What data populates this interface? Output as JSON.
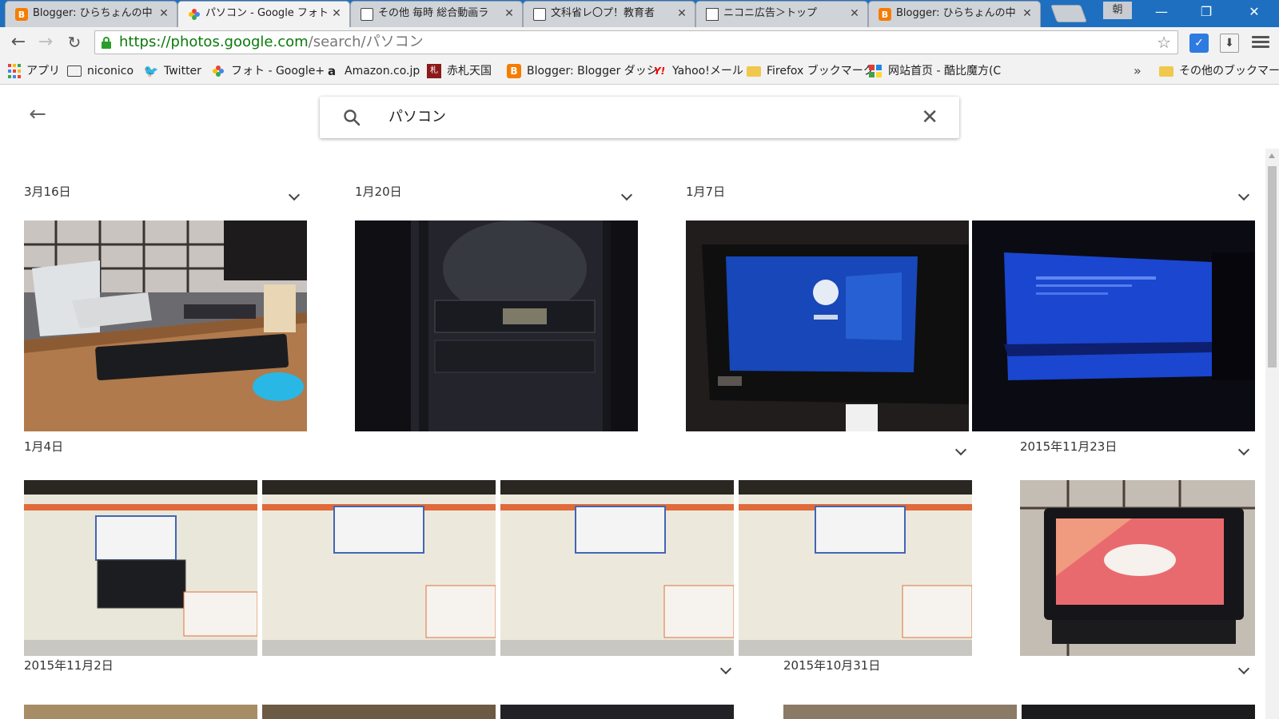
{
  "browser": {
    "tabs": [
      {
        "title": "Blogger: ひらちょんの中",
        "icon": "blogger-icon",
        "active": false
      },
      {
        "title": "パソコン - Google フォト",
        "icon": "google-photos-icon",
        "active": true
      },
      {
        "title": "その他 毎時 総合動画ラ",
        "icon": "niconico-tv-icon",
        "active": false
      },
      {
        "title": "文科省レ〇プ！教育者",
        "icon": "niconico-tv-icon",
        "active": false
      },
      {
        "title": "ニコニ広告＞トップ",
        "icon": "nicoad-icon",
        "active": false
      },
      {
        "title": "Blogger: ひらちょんの中",
        "icon": "blogger-icon",
        "active": false
      }
    ],
    "ime_indicator": "朝",
    "url": {
      "scheme_host": "https://photos.google.com",
      "path": "/search/パソコン"
    },
    "bookmarks": [
      {
        "label": "アプリ",
        "icon": "apps-grid-icon"
      },
      {
        "label": "niconico",
        "icon": "niconico-tv-icon"
      },
      {
        "label": "Twitter",
        "icon": "twitter-bird-icon"
      },
      {
        "label": "フォト - Google+",
        "icon": "google-photos-icon"
      },
      {
        "label": "Amazon.co.jp",
        "icon": "amazon-icon"
      },
      {
        "label": "赤札天国",
        "icon": "akafuda-icon"
      },
      {
        "label": "Blogger: Blogger ダッシ",
        "icon": "blogger-icon"
      },
      {
        "label": "Yahoo!メール",
        "icon": "yahoo-icon"
      },
      {
        "label": "Firefox ブックマーク",
        "icon": "folder-icon"
      },
      {
        "label": "网站首页 - 酷比魔方(C",
        "icon": "cube-site-icon"
      }
    ],
    "bookmarks_overflow": "»",
    "other_bookmarks": "その他のブックマーク"
  },
  "photos": {
    "search_query": "パソコン",
    "groups": [
      {
        "date": "3月16日",
        "photo_count": 1,
        "photos": [
          "desk-laptop-keyboard-mouse"
        ]
      },
      {
        "date": "1月20日",
        "photo_count": 1,
        "photos": [
          "pc-case-back-dark"
        ]
      },
      {
        "date": "1月7日",
        "photo_count": 2,
        "photos": [
          "monitor-windows10-login",
          "monitor-blue-screen"
        ]
      },
      {
        "date": "1月4日",
        "photo_count": 4,
        "photos": [
          "laptop-screen-dialog-1",
          "laptop-screen-dialog-2",
          "laptop-screen-dialog-3",
          "laptop-screen-dialog-4"
        ]
      },
      {
        "date": "2015年11月23日",
        "photo_count": 1,
        "photos": [
          "tv-anime-screen"
        ]
      },
      {
        "date": "2015年11月2日",
        "photo_count": 3,
        "photos": [
          "partial-1",
          "partial-2",
          "partial-3"
        ]
      },
      {
        "date": "2015年10月31日",
        "photo_count": 2,
        "photos": [
          "partial-4",
          "partial-5"
        ]
      }
    ]
  },
  "colors": {
    "tabstrip": "#1e6fbf",
    "https_green": "#0a7a0a",
    "blogger_orange": "#f57d00"
  }
}
